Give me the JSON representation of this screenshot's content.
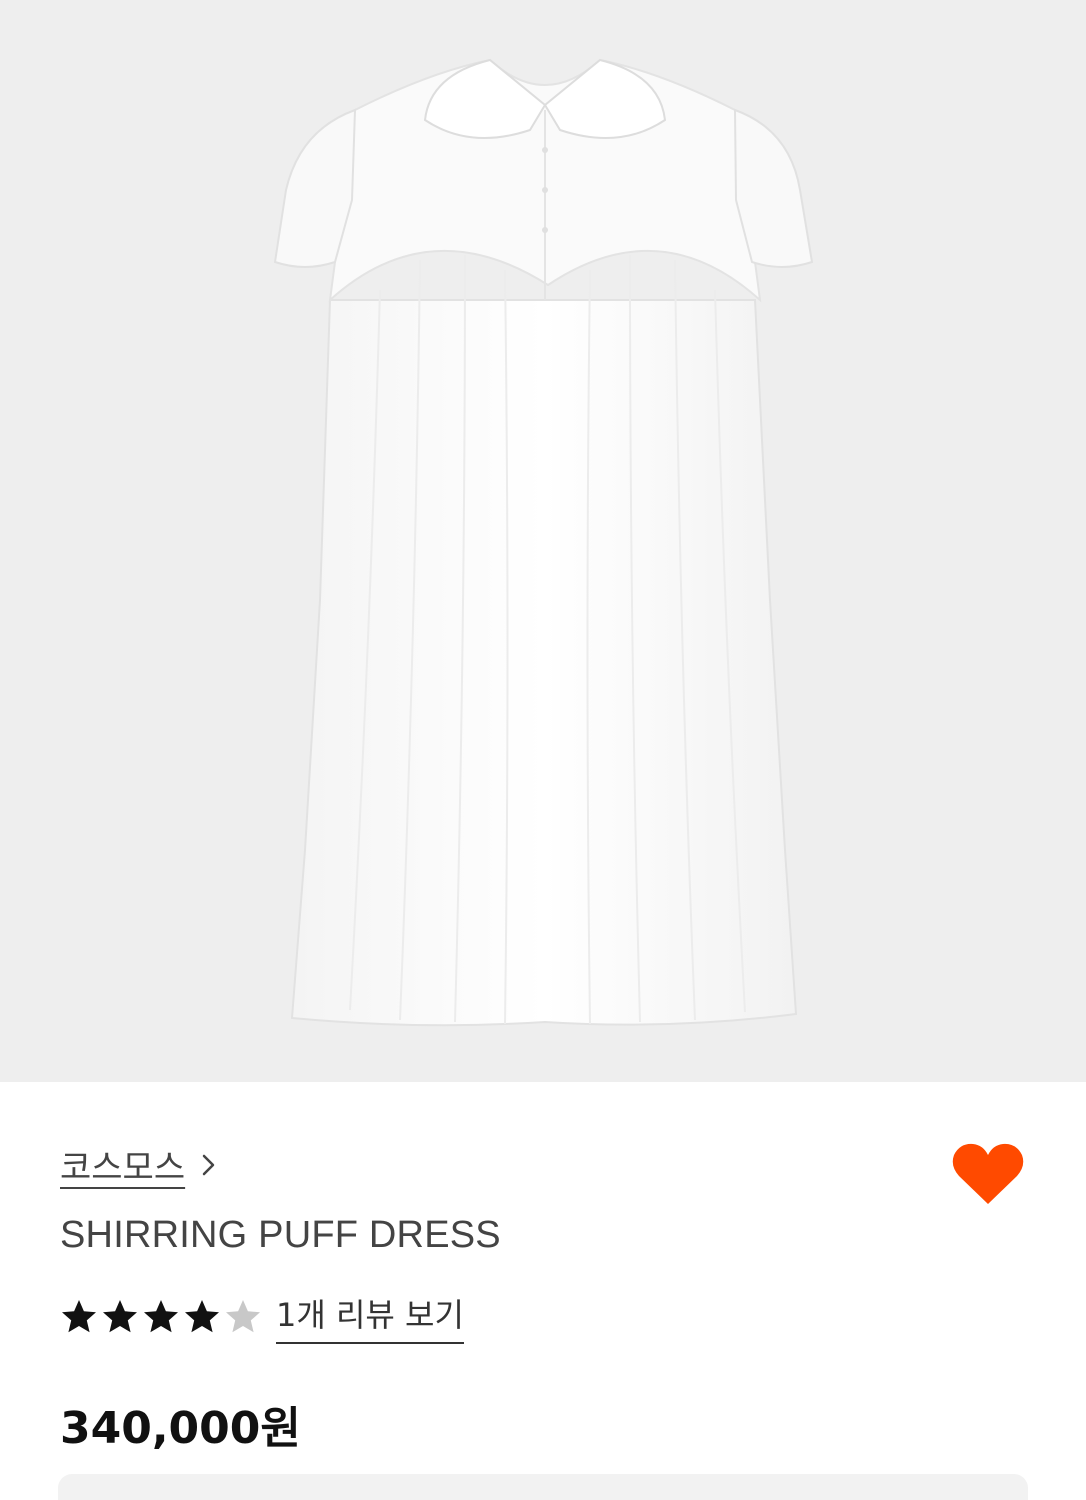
{
  "product_image": {
    "alt": "white dress",
    "background_color": "#eeeeee"
  },
  "brand": {
    "name": "코스모스",
    "chevron_icon": "chevron-right-icon"
  },
  "wishlist": {
    "icon": "heart-icon",
    "color": "#ff4a00",
    "active": true
  },
  "product": {
    "title": "SHIRRING PUFF DRESS",
    "price": "340,000원"
  },
  "rating": {
    "stars_filled": 4,
    "stars_total": 5,
    "filled_color": "#111111",
    "empty_color": "#c8c8c8",
    "review_link": "1개 리뷰 보기"
  }
}
